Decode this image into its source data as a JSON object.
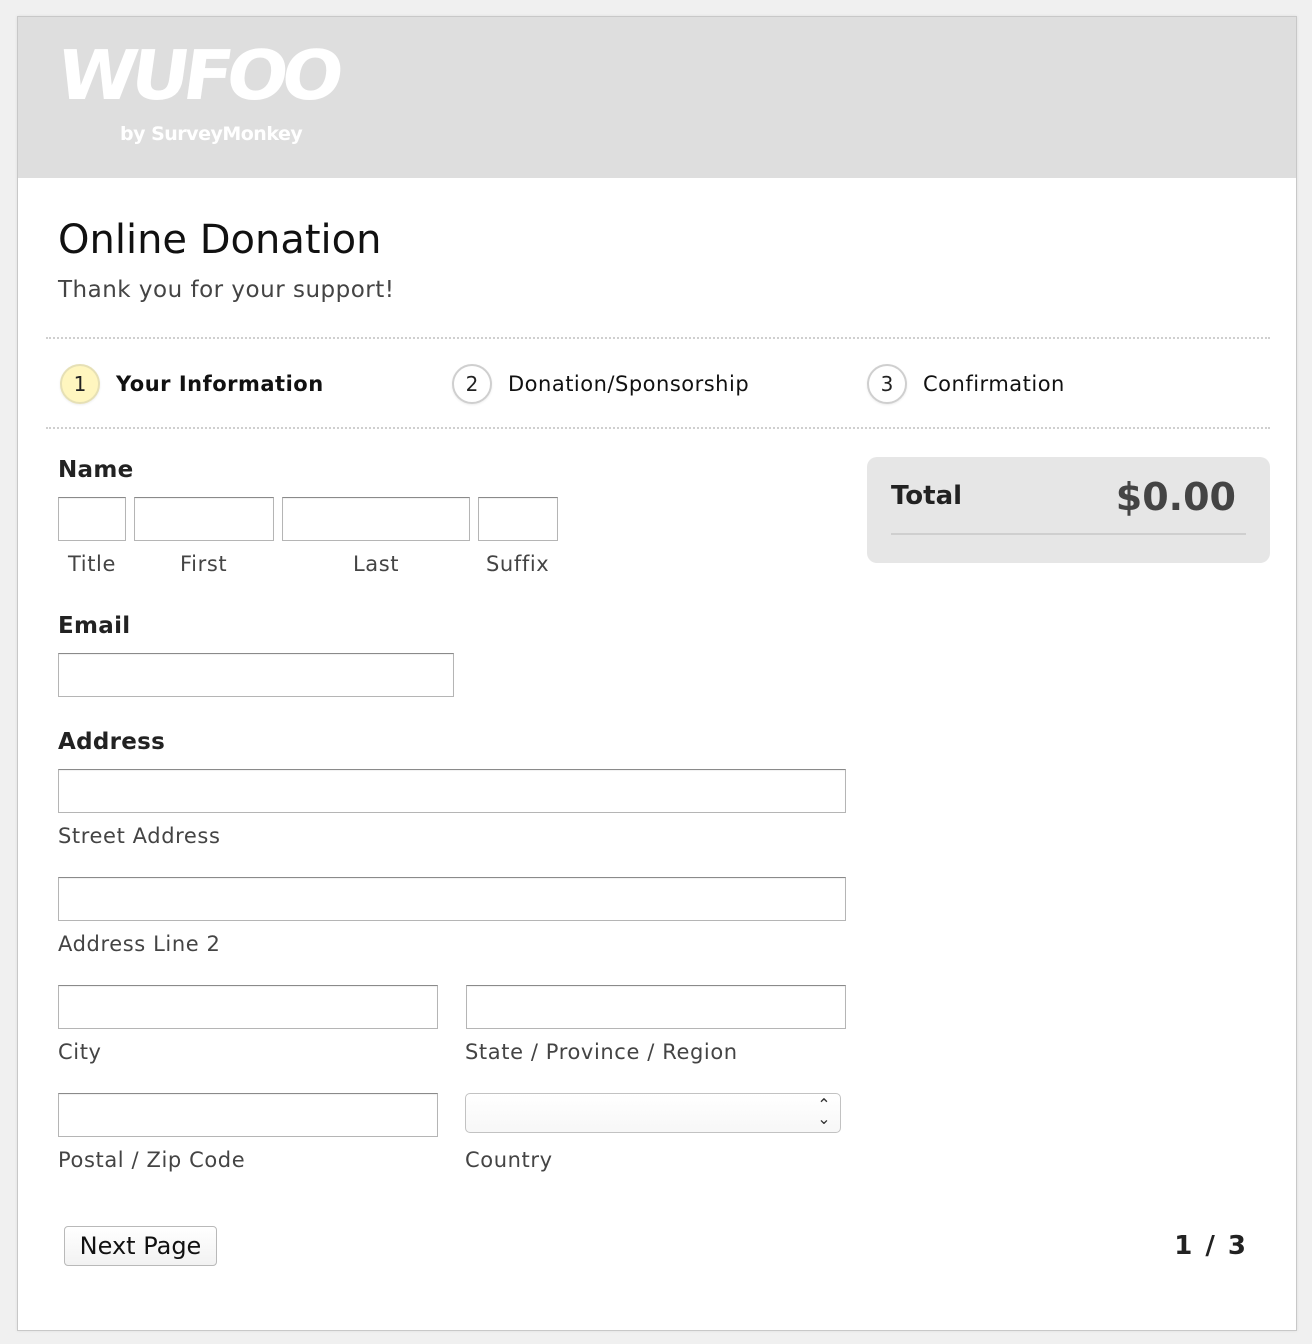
{
  "logo": {
    "main": "WUFOO",
    "sub": "by SurveyMonkey"
  },
  "form": {
    "title": "Online Donation",
    "description": "Thank you for your support!"
  },
  "steps": [
    {
      "number": "1",
      "label": "Your Information",
      "active": true
    },
    {
      "number": "2",
      "label": "Donation/Sponsorship",
      "active": false
    },
    {
      "number": "3",
      "label": "Confirmation",
      "active": false
    }
  ],
  "fields": {
    "name": {
      "label": "Name",
      "parts": [
        {
          "label": "Title",
          "value": ""
        },
        {
          "label": "First",
          "value": ""
        },
        {
          "label": "Last",
          "value": ""
        },
        {
          "label": "Suffix",
          "value": ""
        }
      ]
    },
    "email": {
      "label": "Email",
      "value": ""
    },
    "address": {
      "label": "Address",
      "street": {
        "label": "Street Address",
        "value": ""
      },
      "line2": {
        "label": "Address Line 2",
        "value": ""
      },
      "city": {
        "label": "City",
        "value": ""
      },
      "state": {
        "label": "State / Province / Region",
        "value": ""
      },
      "postal": {
        "label": "Postal / Zip Code",
        "value": ""
      },
      "country": {
        "label": "Country",
        "selected": ""
      }
    }
  },
  "total": {
    "label": "Total",
    "value": "$0.00"
  },
  "buttons": {
    "next": "Next Page"
  },
  "pager": "1 / 3",
  "colors": {
    "header_band": "#dedede",
    "active_step": "#fff6bf",
    "total_box": "#e6e6e6"
  }
}
